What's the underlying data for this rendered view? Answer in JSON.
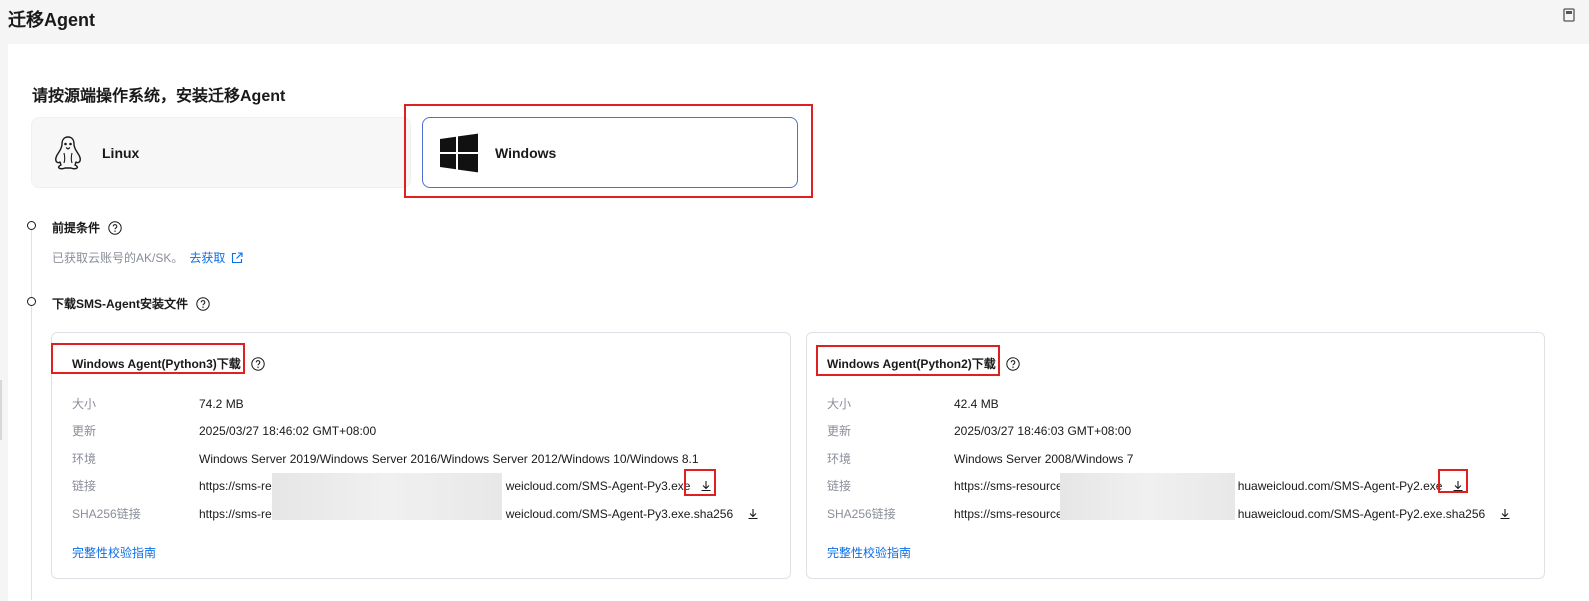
{
  "page": {
    "title": "迁移Agent"
  },
  "os_select": {
    "heading": "请按源端操作系统，安装迁移Agent",
    "options": [
      {
        "label": "Linux",
        "icon": "linux-tux-icon",
        "selected": false
      },
      {
        "label": "Windows",
        "icon": "windows-logo-icon",
        "selected": true
      }
    ]
  },
  "steps": {
    "prereq": {
      "title": "前提条件",
      "desc": "已获取云账号的AK/SK。",
      "link": "去获取"
    },
    "download": {
      "title": "下载SMS-Agent安装文件"
    }
  },
  "agents": {
    "py3": {
      "title": "Windows Agent(Python3)下载",
      "labels": {
        "size": "大小",
        "updated": "更新",
        "env": "环境",
        "link": "链接",
        "sha": "SHA256链接"
      },
      "size": "74.2 MB",
      "updated": "2025/03/27 18:46:02 GMT+08:00",
      "env": "Windows Server 2019/Windows Server 2016/Windows Server 2012/Windows 10/Windows 8.1",
      "link_prefix": "https://sms-res",
      "link_suffix": "weicloud.com/SMS-Agent-Py3.exe",
      "sha_prefix": "https://sms-res",
      "sha_suffix": "weicloud.com/SMS-Agent-Py3.exe.sha256",
      "guide": "完整性校验指南"
    },
    "py2": {
      "title": "Windows Agent(Python2)下载",
      "labels": {
        "size": "大小",
        "updated": "更新",
        "env": "环境",
        "link": "链接",
        "sha": "SHA256链接"
      },
      "size": "42.4 MB",
      "updated": "2025/03/27 18:46:03 GMT+08:00",
      "env": "Windows Server 2008/Windows 7",
      "link_prefix": "https://sms-resource",
      "link_suffix": "huaweicloud.com/SMS-Agent-Py2.exe",
      "sha_prefix": "https://sms-resource",
      "sha_suffix": "huaweicloud.com/SMS-Agent-Py2.exe.sha256",
      "guide": "完整性校验指南"
    }
  }
}
